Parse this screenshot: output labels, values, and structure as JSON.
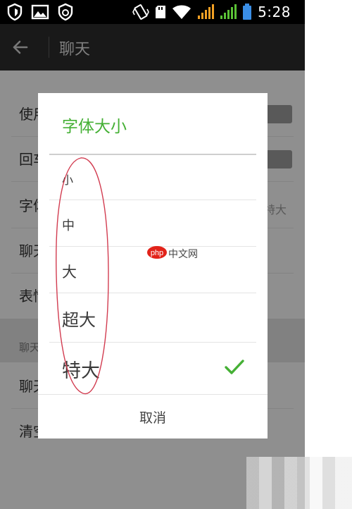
{
  "status_bar": {
    "time": "5:28",
    "icons_left": [
      "shield-icon",
      "image-icon",
      "sync-icon"
    ],
    "icons_right": [
      "vibrate-icon",
      "sd-card-icon",
      "wifi-icon",
      "signal-icon",
      "signal-icon",
      "battery-icon"
    ]
  },
  "action_bar": {
    "title": "聊天",
    "back_icon": "back-arrow-icon"
  },
  "settings": {
    "rows": [
      {
        "label": "使用",
        "type": "toggle"
      },
      {
        "label": "回车",
        "type": "toggle"
      },
      {
        "label": "字体",
        "type": "value",
        "value": "特大"
      },
      {
        "label": "聊天",
        "type": "none"
      },
      {
        "label": "表情",
        "type": "none"
      }
    ],
    "section_header": "聊天",
    "rows2": [
      {
        "label": "聊天"
      },
      {
        "label": "清空"
      }
    ]
  },
  "dialog": {
    "title": "字体大小",
    "options": [
      {
        "label": "小",
        "selected": false
      },
      {
        "label": "中",
        "selected": false
      },
      {
        "label": "大",
        "selected": false
      },
      {
        "label": "超大",
        "selected": false
      },
      {
        "label": "特大",
        "selected": true
      }
    ],
    "cancel_label": "取消"
  },
  "watermark": {
    "logo_text": "php",
    "text": "中文网"
  },
  "colors": {
    "accent_green": "#45b035",
    "annotation_red": "#d23c50",
    "watermark_red": "#e2231a"
  }
}
